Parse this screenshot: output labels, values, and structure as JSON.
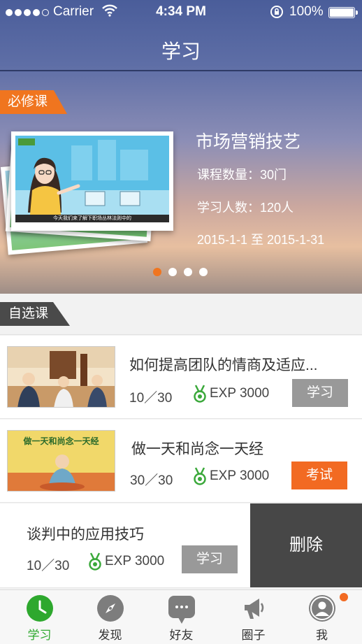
{
  "status_bar": {
    "carrier": "Carrier",
    "time": "4:34 PM",
    "battery": "100%"
  },
  "nav": {
    "title": "学习"
  },
  "required_section": {
    "tag": "必修课",
    "course": {
      "title": "市场营销技艺",
      "count_text": "课程数量：30门",
      "learners_text": "学习人数：120人",
      "date_range": "2015-1-1 至 2015-1-31",
      "thumb_caption": "今天我们来了解下职场丛林法则中的"
    },
    "pager": {
      "total": 4,
      "active_index": 0
    }
  },
  "elective_section": {
    "tag": "自选课",
    "courses": [
      {
        "title": "如何提高团队的情商及适应...",
        "progress": "10／30",
        "exp": "EXP 3000",
        "action": "学习",
        "action_style": "grey"
      },
      {
        "title": "做一天和尚念一天经",
        "progress": "30／30",
        "exp": "EXP 3000",
        "action": "考试",
        "action_style": "orange",
        "thumb_text": "做一天和尚念一天经"
      },
      {
        "title": "谈判中的应用技巧",
        "progress": "10／30",
        "exp": "EXP 3000",
        "action": "学习",
        "action_style": "grey"
      }
    ],
    "swipe_action": "删除"
  },
  "tabs": [
    {
      "label": "学习",
      "icon": "clock-icon",
      "active": true
    },
    {
      "label": "发现",
      "icon": "compass-icon",
      "active": false
    },
    {
      "label": "好友",
      "icon": "chat-bubble-icon",
      "active": false
    },
    {
      "label": "圈子",
      "icon": "megaphone-icon",
      "active": false
    },
    {
      "label": "我",
      "icon": "user-avatar-icon",
      "active": false,
      "badge": true
    }
  ],
  "colors": {
    "accent": "#f26a22",
    "active_tab": "#2ea82e",
    "exp_icon": "#3aa83a",
    "dark_tag": "#4a4a4a"
  }
}
